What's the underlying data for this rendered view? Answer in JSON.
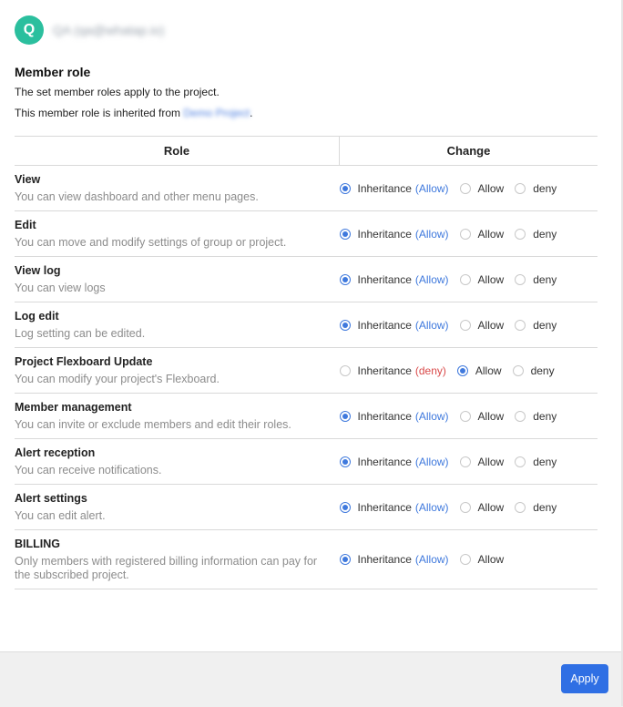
{
  "user": {
    "initial": "Q",
    "name": "QA (qa@whatap.io)"
  },
  "section": {
    "title": "Member role",
    "description": "The set member roles apply to the project.",
    "inherited_prefix": "This member role is inherited from ",
    "inherited_project": "Demo Project",
    "inherited_suffix": "."
  },
  "table": {
    "headers": {
      "role": "Role",
      "change": "Change"
    },
    "option_labels": {
      "inheritance": "Inheritance",
      "allow": "Allow",
      "deny": "deny"
    },
    "rows": [
      {
        "name": "View",
        "description": "You can view dashboard and other menu pages.",
        "inherited_value": "(Allow)",
        "selected": "inheritance"
      },
      {
        "name": "Edit",
        "description": "You can move and modify settings of group or project.",
        "inherited_value": "(Allow)",
        "selected": "inheritance"
      },
      {
        "name": "View log",
        "description": "You can view logs",
        "inherited_value": "(Allow)",
        "selected": "inheritance"
      },
      {
        "name": "Log edit",
        "description": "Log setting can be edited.",
        "inherited_value": "(Allow)",
        "selected": "inheritance"
      },
      {
        "name": "Project Flexboard Update",
        "description": "You can modify your project's Flexboard.",
        "inherited_value": "(deny)",
        "selected": "allow"
      },
      {
        "name": "Member management",
        "description": "You can invite or exclude members and edit their roles.",
        "inherited_value": "(Allow)",
        "selected": "inheritance"
      },
      {
        "name": "Alert reception",
        "description": "You can receive notifications.",
        "inherited_value": "(Allow)",
        "selected": "inheritance"
      },
      {
        "name": "Alert settings",
        "description": "You can edit alert.",
        "inherited_value": "(Allow)",
        "selected": "inheritance"
      },
      {
        "name": "BILLING",
        "description": "Only members with registered billing information can pay for the subscribed project.",
        "inherited_value": "(Allow)",
        "selected": "inheritance",
        "no_deny": true
      }
    ]
  },
  "footer": {
    "apply_label": "Apply"
  },
  "colors": {
    "accent": "#2f6fe4",
    "avatar": "#2bbf9e",
    "deny": "#d94a4a"
  }
}
